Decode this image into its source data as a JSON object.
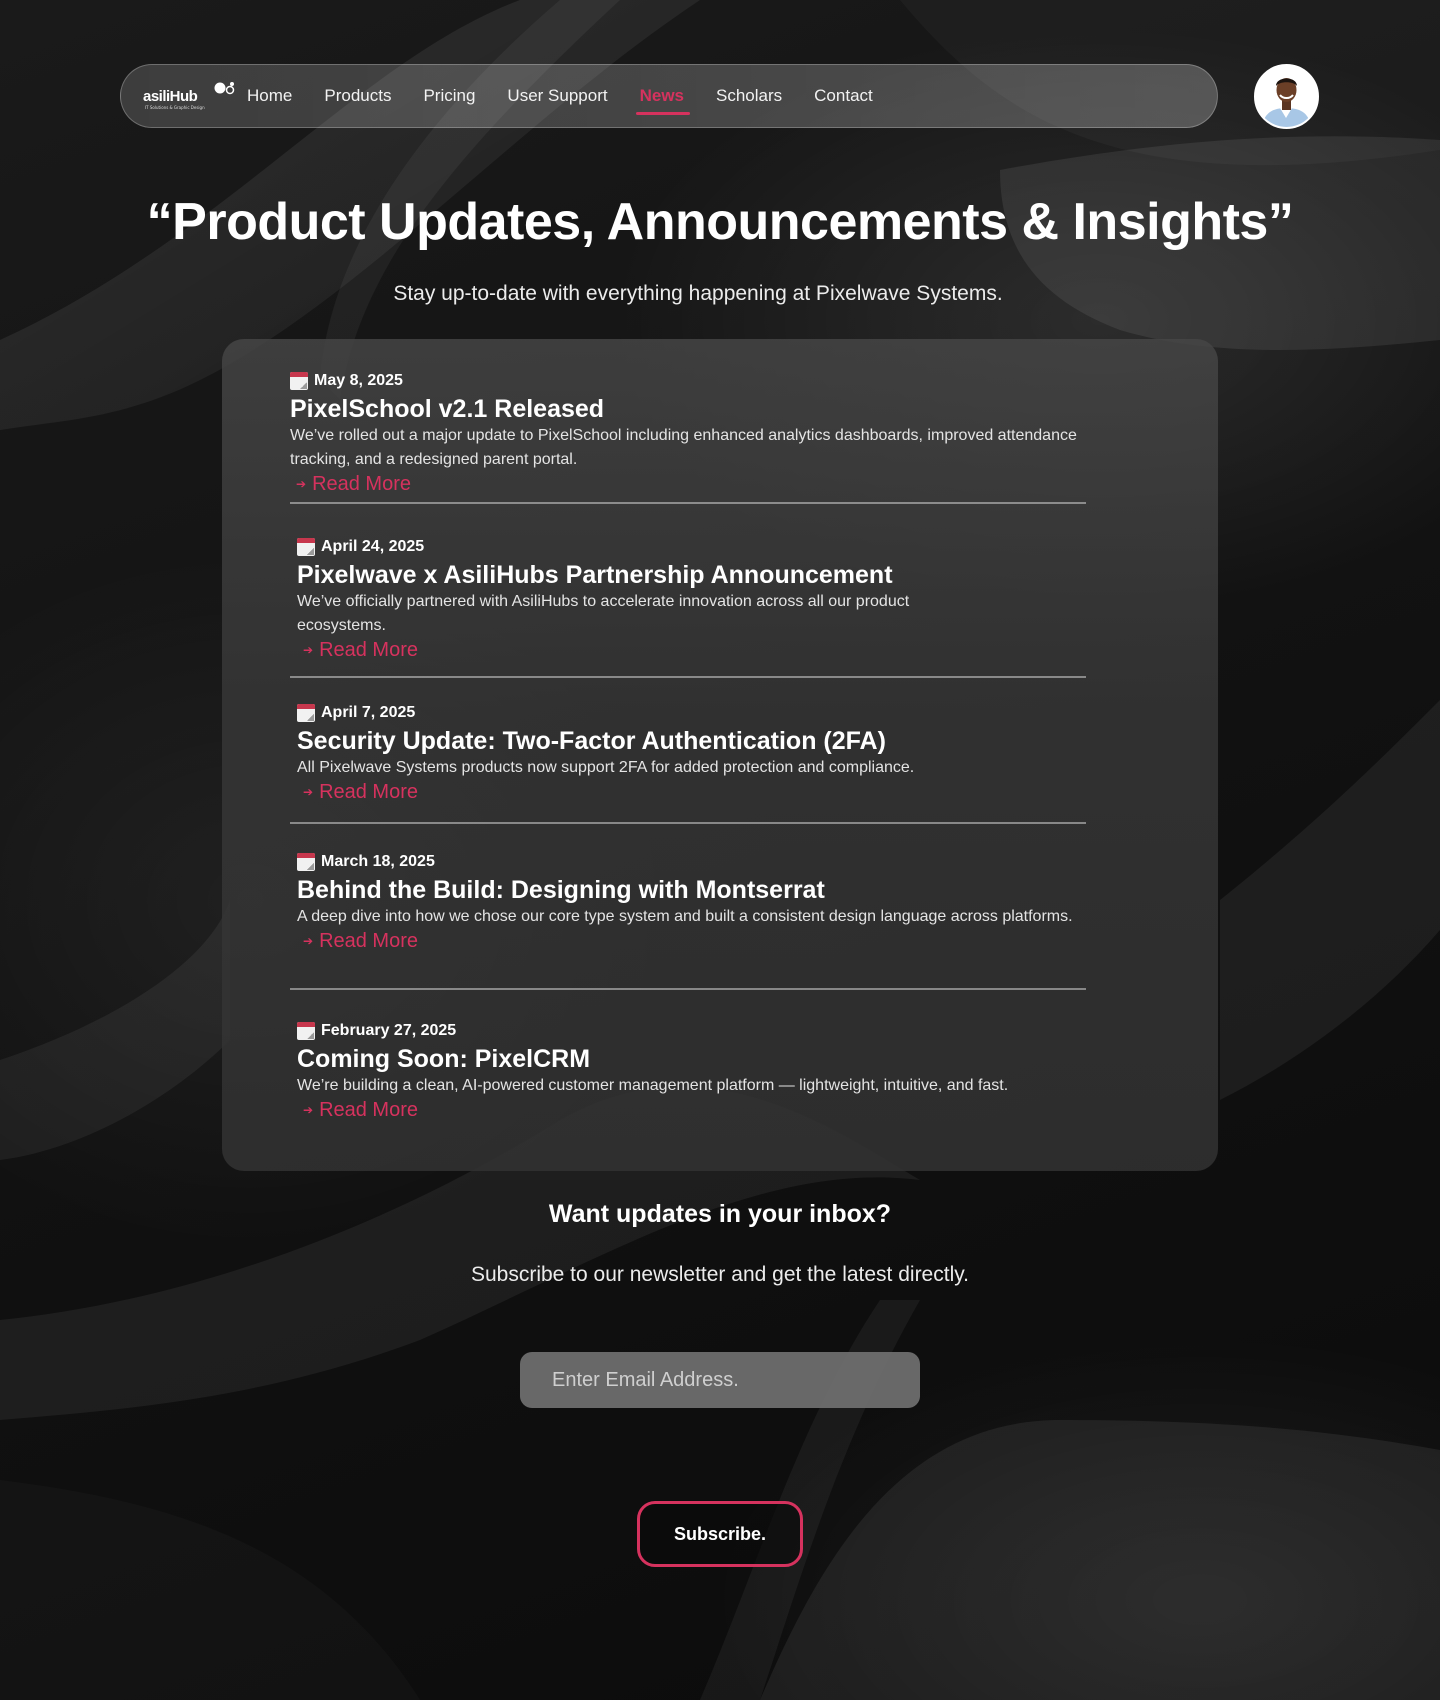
{
  "brand": {
    "logo_text": "asiliHub",
    "logo_tagline": "IT Solutions & Graphic Design"
  },
  "nav": {
    "items": [
      {
        "label": "Home",
        "active": false
      },
      {
        "label": "Products",
        "active": false
      },
      {
        "label": "Pricing",
        "active": false
      },
      {
        "label": "User Support",
        "active": false
      },
      {
        "label": "News",
        "active": true
      },
      {
        "label": "Scholars",
        "active": false
      },
      {
        "label": "Contact",
        "active": false
      }
    ]
  },
  "hero": {
    "title": "“Product Updates, Announcements & Insights”",
    "subtitle": "Stay up-to-date with everything happening at Pixelwave Systems."
  },
  "news": {
    "read_more_label": "Read More",
    "items": [
      {
        "date": "May 8, 2025",
        "title": "PixelSchool v2.1 Released",
        "description": "We’ve rolled out a major update to PixelSchool including enhanced analytics dashboards, improved attendance tracking, and a redesigned parent portal."
      },
      {
        "date": "April 24, 2025",
        "title": "Pixelwave x AsiliHubs Partnership Announcement",
        "description": "We’ve officially partnered with AsiliHubs to accelerate innovation across all our product ecosystems."
      },
      {
        "date": "April 7, 2025",
        "title": "Security Update: Two-Factor Authentication (2FA)",
        "description": "All Pixelwave Systems products now support 2FA for added protection and compliance."
      },
      {
        "date": "March 18, 2025",
        "title": "Behind the Build: Designing with Montserrat",
        "description": "A deep dive into how we chose our core type system and built a consistent design language across platforms."
      },
      {
        "date": "February 27, 2025",
        "title": "Coming Soon: PixelCRM",
        "description": "We’re building a clean, AI-powered customer management platform — lightweight, intuitive, and fast."
      }
    ]
  },
  "newsletter": {
    "title": "Want updates in your inbox?",
    "subtitle": "Subscribe to our newsletter and get the latest directly.",
    "email_placeholder": "Enter Email Address.",
    "email_value": "",
    "button_label": "Subscribe."
  },
  "colors": {
    "accent": "#d6325e",
    "background": "#121212",
    "card": "#3a3a3a",
    "input": "#7a7a7a"
  },
  "icons": {
    "date_icon": "calendar-icon",
    "read_more_icon": "arrow-right-icon"
  }
}
